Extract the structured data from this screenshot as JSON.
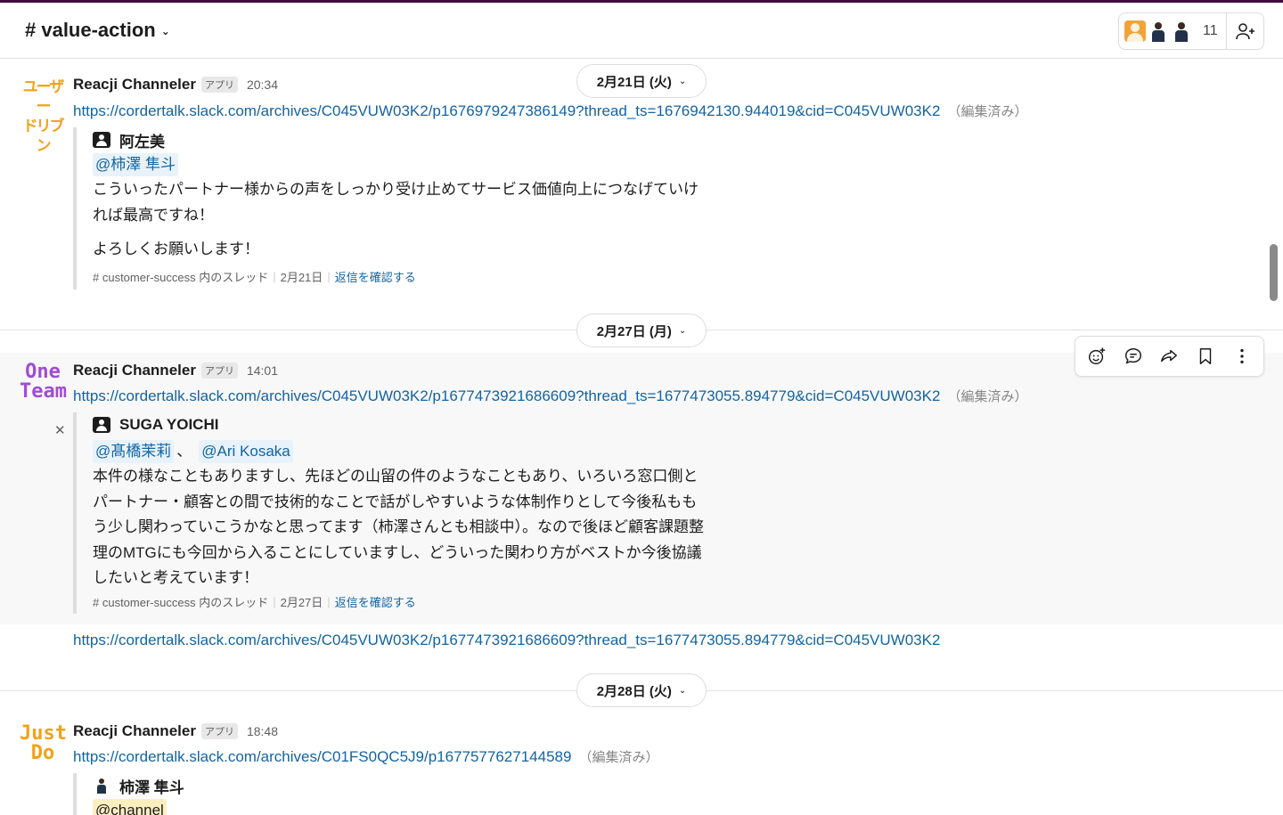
{
  "header": {
    "channel": "# value-action",
    "member_count": "11"
  },
  "dates": [
    "2月21日 (火)",
    "2月27日 (月)",
    "2月28日 (火)"
  ],
  "messages": [
    {
      "avatar_lines": [
        "ユーザー",
        "ドリブン"
      ],
      "avatar_color": "#f0a21a",
      "author": "Reacji Channeler",
      "badge": "アプリ",
      "time": "20:34",
      "link": "https://cordertalk.slack.com/archives/C045VUW03K2/p1676979247386149?thread_ts=1676942130.944019&cid=C045VUW03K2",
      "edited": "（編集済み）",
      "quote": {
        "author": "阿左美",
        "mention": "@柿澤 隼斗",
        "lines": [
          "こういったパートナー様からの声をしっかり受け止めてサービス価値向上につなげていけ",
          "れば最高ですね！"
        ],
        "extra": "よろしくお願いします！",
        "channel": "# customer-success 内のスレッド",
        "date": "2月21日",
        "reply": "返信を確認する"
      }
    },
    {
      "avatar_lines": [
        "One",
        "Team"
      ],
      "avatar_color": "#a14bd4",
      "author": "Reacji Channeler",
      "badge": "アプリ",
      "time": "14:01",
      "link": "https://cordertalk.slack.com/archives/C045VUW03K2/p1677473921686609?thread_ts=1677473055.894779&cid=C045VUW03K2",
      "edited": "（編集済み）",
      "quote": {
        "author": "SUGA YOICHI",
        "mention1": "@髙橋茉莉",
        "mention_sep": "、",
        "mention2": "@Ari Kosaka",
        "lines": [
          "本件の様なこともありますし、先ほどの山留の件のようなこともあり、いろいろ窓口側と",
          "パートナー・顧客との間で技術的なことで話がしやすいような体制作りとして今後私もも",
          "う少し関わっていこうかなと思ってます（柿澤さんとも相談中）。なので後ほど顧客課題整",
          "理のMTGにも今回から入ることにしていますし、どういった関わり方がベストか今後協議",
          "したいと考えています！"
        ],
        "channel": "# customer-success 内のスレッド",
        "date": "2月27日",
        "reply": "返信を確認する"
      },
      "followup_link": "https://cordertalk.slack.com/archives/C045VUW03K2/p1677473921686609?thread_ts=1677473055.894779&cid=C045VUW03K2"
    },
    {
      "avatar_lines": [
        "Just",
        "Do"
      ],
      "avatar_color": "#f0a21a",
      "author": "Reacji Channeler",
      "badge": "アプリ",
      "time": "18:48",
      "link": "https://cordertalk.slack.com/archives/C01FS0QC5J9/p1677577627144589",
      "edited": "（編集済み）",
      "quote": {
        "author": "柿澤 隼斗",
        "mention": "@channel"
      }
    }
  ],
  "icons": [
    "chevron-down-icon",
    "add-member-icon",
    "add-reaction-icon",
    "reply-in-thread-icon",
    "share-icon",
    "bookmark-icon",
    "more-actions-icon",
    "close-icon"
  ]
}
